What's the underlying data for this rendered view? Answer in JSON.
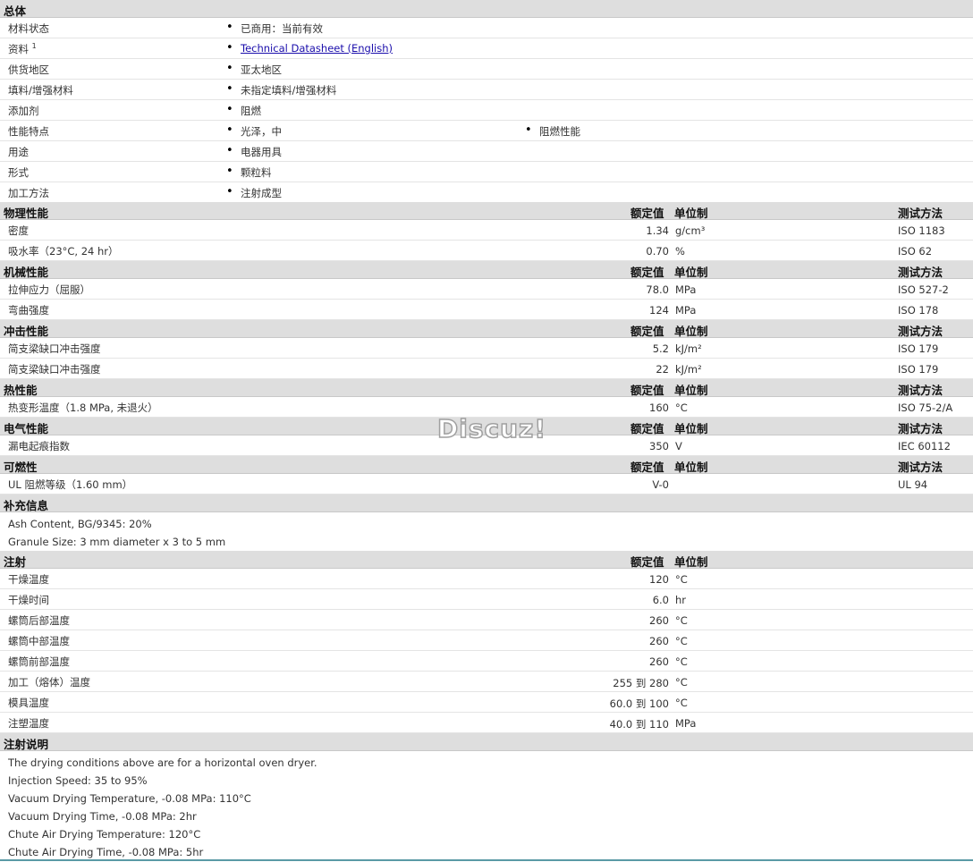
{
  "watermark": "Discuz!",
  "hdr": {
    "value": "额定值",
    "unit": "单位制",
    "method": "测试方法"
  },
  "general": {
    "title": "总体",
    "rows": [
      {
        "label": "材料状态",
        "items": [
          "已商用：当前有效"
        ]
      },
      {
        "label": "资料",
        "sup": "1",
        "link": "Technical Datasheet (English)"
      },
      {
        "label": "供货地区",
        "items": [
          "亚太地区"
        ]
      },
      {
        "label": "填料/增强材料",
        "items": [
          "未指定填料/增强材料"
        ]
      },
      {
        "label": "添加剂",
        "items": [
          "阻燃"
        ]
      },
      {
        "label": "性能特点",
        "items": [
          "光泽，中",
          "阻燃性能"
        ]
      },
      {
        "label": "用途",
        "items": [
          "电器用具"
        ]
      },
      {
        "label": "形式",
        "items": [
          "颗粒料"
        ]
      },
      {
        "label": "加工方法",
        "items": [
          "注射成型"
        ]
      }
    ]
  },
  "physical": {
    "title": "物理性能",
    "rows": [
      {
        "label": "密度",
        "value": "1.34",
        "unit": "g/cm³",
        "method": "ISO 1183"
      },
      {
        "label": "吸水率（23°C, 24 hr）",
        "value": "0.70",
        "unit": "%",
        "method": "ISO 62"
      }
    ]
  },
  "mechanical": {
    "title": "机械性能",
    "rows": [
      {
        "label": "拉伸应力（屈服）",
        "value": "78.0",
        "unit": "MPa",
        "method": "ISO 527-2"
      },
      {
        "label": "弯曲强度",
        "value": "124",
        "unit": "MPa",
        "method": "ISO 178"
      }
    ]
  },
  "impact": {
    "title": "冲击性能",
    "rows": [
      {
        "label": "简支梁缺口冲击强度",
        "value": "5.2",
        "unit": "kJ/m²",
        "method": "ISO 179"
      },
      {
        "label": "简支梁缺口冲击强度",
        "value": "22",
        "unit": "kJ/m²",
        "method": "ISO 179"
      }
    ]
  },
  "thermal": {
    "title": "热性能",
    "rows": [
      {
        "label": "热变形温度（1.8 MPa, 未退火）",
        "value": "160",
        "unit": "°C",
        "method": "ISO 75-2/A"
      }
    ]
  },
  "electrical": {
    "title": "电气性能",
    "rows": [
      {
        "label": "漏电起痕指数",
        "value": "350",
        "unit": "V",
        "method": "IEC 60112"
      }
    ]
  },
  "flammability": {
    "title": "可燃性",
    "rows": [
      {
        "label": "UL 阻燃等级（1.60 mm）",
        "value": "V-0",
        "unit": "",
        "method": "UL 94"
      }
    ]
  },
  "supplement": {
    "title": "补充信息",
    "notes": [
      "Ash Content, BG/9345: 20%",
      "Granule Size: 3 mm diameter x 3 to 5 mm"
    ]
  },
  "injection": {
    "title": "注射",
    "rows": [
      {
        "label": "干燥温度",
        "value": "120",
        "unit": "°C"
      },
      {
        "label": "干燥时间",
        "value": "6.0",
        "unit": "hr"
      },
      {
        "label": "螺筒后部温度",
        "value": "260",
        "unit": "°C"
      },
      {
        "label": "螺筒中部温度",
        "value": "260",
        "unit": "°C"
      },
      {
        "label": "螺筒前部温度",
        "value": "260",
        "unit": "°C"
      },
      {
        "label": "加工（熔体）温度",
        "value": "255 到 280",
        "unit": "°C"
      },
      {
        "label": "模具温度",
        "value": "60.0 到 100",
        "unit": "°C"
      },
      {
        "label": "注塑温度",
        "value": "40.0 到 110",
        "unit": "MPa"
      }
    ]
  },
  "injection_notes": {
    "title": "注射说明",
    "notes": [
      "The drying conditions above are for a horizontal oven dryer.",
      "Injection Speed: 35 to 95%",
      "Vacuum Drying Temperature, -0.08 MPa: 110°C",
      "Vacuum Drying Time, -0.08 MPa: 2hr",
      "Chute Air Drying Temperature: 120°C",
      "Chute Air Drying Time, -0.08 MPa: 5hr"
    ]
  }
}
